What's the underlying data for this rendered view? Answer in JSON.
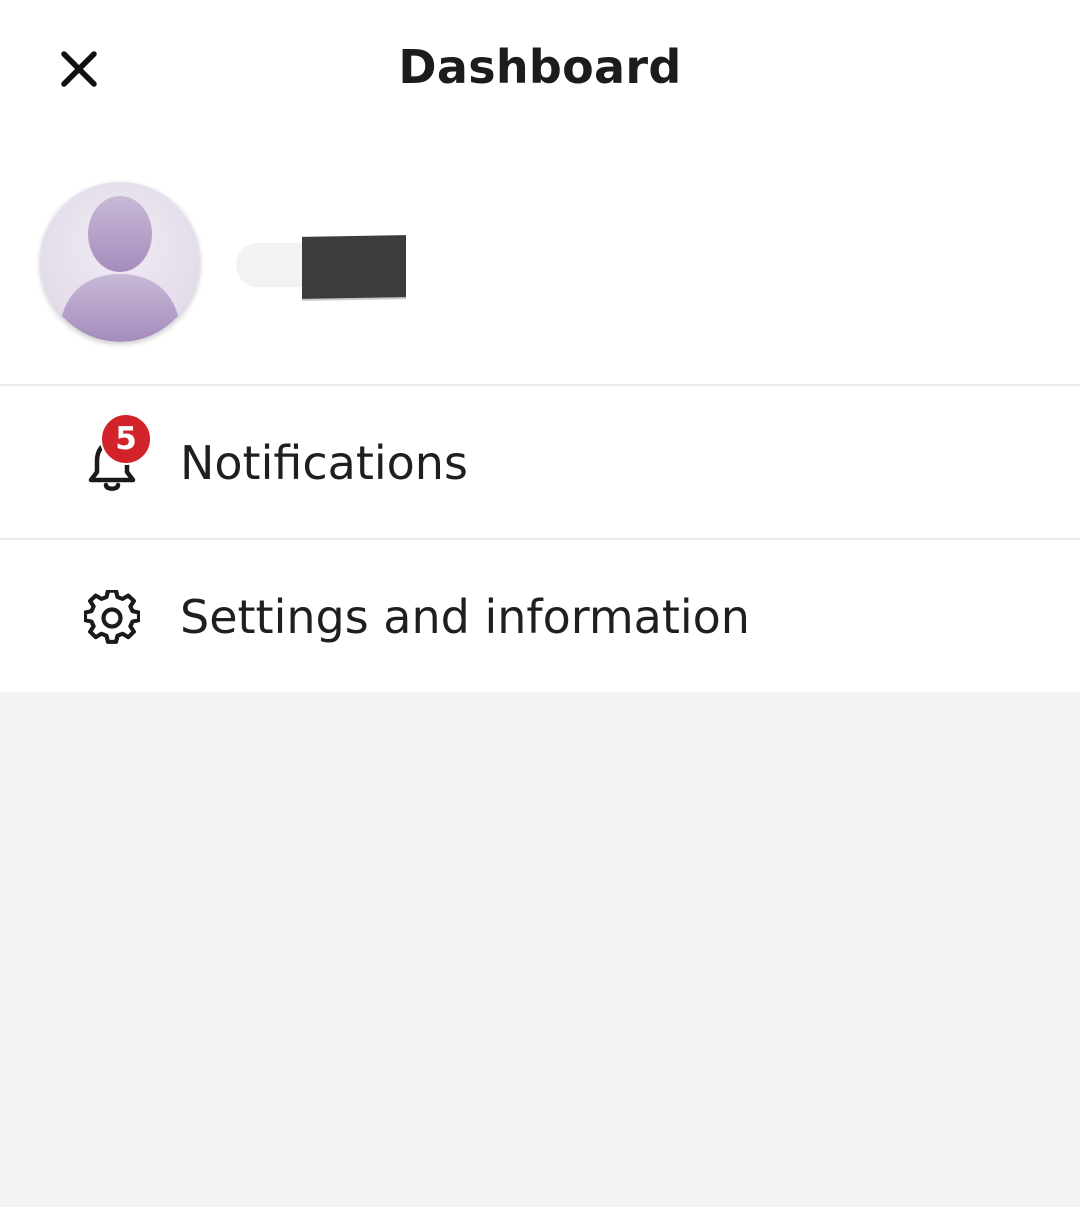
{
  "header": {
    "title": "Dashboard",
    "close_icon": "close-icon"
  },
  "profile": {
    "avatar_icon": "default-user-avatar",
    "name_redacted": true
  },
  "menu": [
    {
      "label": "Notifications",
      "icon": "bell-icon",
      "badge": "5"
    },
    {
      "label": "Settings and information",
      "icon": "gear-icon"
    }
  ],
  "colors": {
    "badge": "#d2232a",
    "background": "#f3f3f3",
    "panel": "#ffffff",
    "avatar_accent": "#a68fbd"
  }
}
